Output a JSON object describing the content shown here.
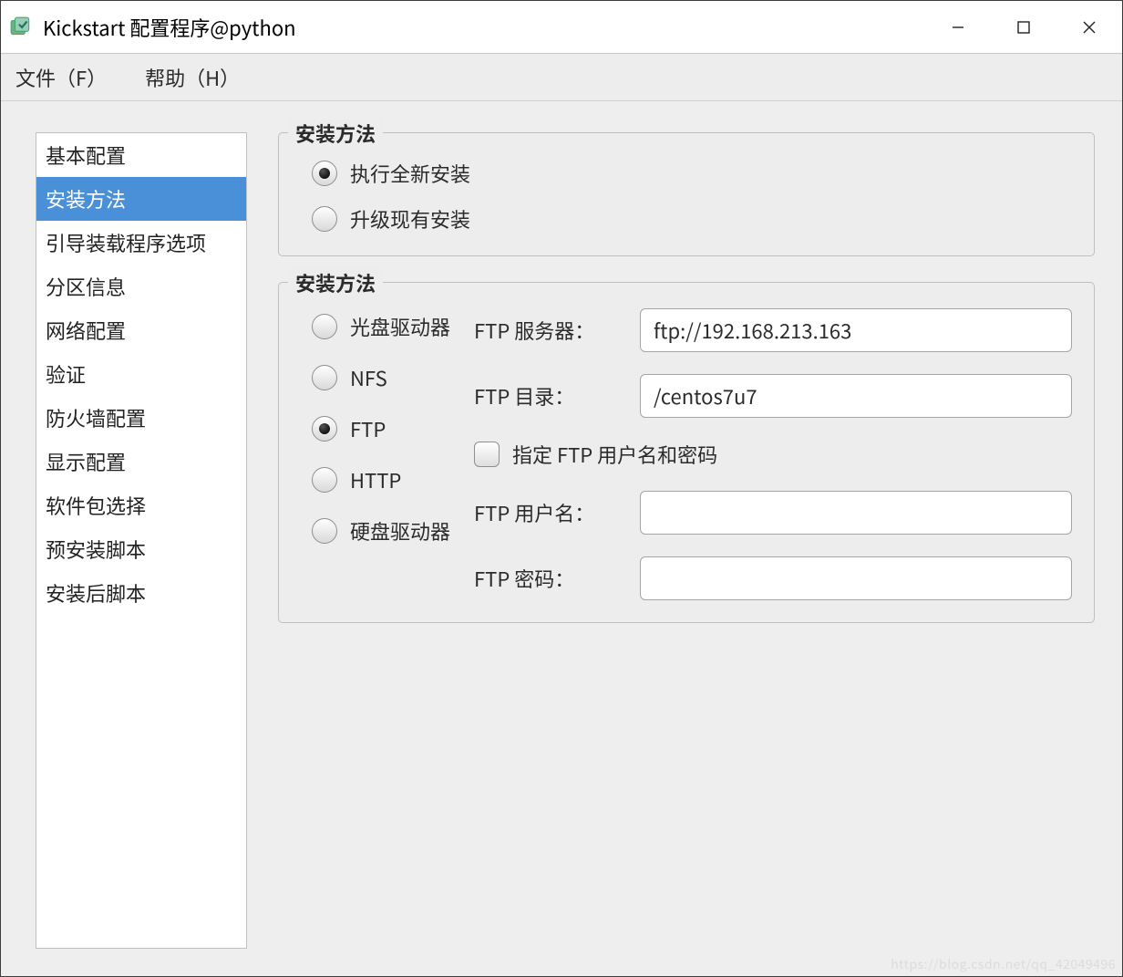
{
  "title": "Kickstart 配置程序@python",
  "menubar": {
    "file": "文件（F）",
    "help": "帮助（H）"
  },
  "sidebar": {
    "items": [
      {
        "label": "基本配置"
      },
      {
        "label": "安装方法"
      },
      {
        "label": "引导装载程序选项"
      },
      {
        "label": "分区信息"
      },
      {
        "label": "网络配置"
      },
      {
        "label": "验证"
      },
      {
        "label": "防火墙配置"
      },
      {
        "label": "显示配置"
      },
      {
        "label": "软件包选择"
      },
      {
        "label": "预安装脚本"
      },
      {
        "label": "安装后脚本"
      }
    ],
    "selectedIndex": 1
  },
  "group1": {
    "legend": "安装方法",
    "options": [
      {
        "label": "执行全新安装",
        "checked": true
      },
      {
        "label": "升级现有安装",
        "checked": false
      }
    ]
  },
  "group2": {
    "legend": "安装方法",
    "methods": [
      {
        "label": "光盘驱动器",
        "checked": false
      },
      {
        "label": "NFS",
        "checked": false
      },
      {
        "label": "FTP",
        "checked": true
      },
      {
        "label": "HTTP",
        "checked": false
      },
      {
        "label": "硬盘驱动器",
        "checked": false
      }
    ],
    "ftp": {
      "server_label": "FTP 服务器：",
      "server_value": "ftp://192.168.213.163",
      "dir_label": "FTP 目录：",
      "dir_value": "/centos7u7",
      "auth_label": "指定 FTP 用户名和密码",
      "auth_checked": false,
      "user_label": "FTP 用户名：",
      "user_value": "",
      "pass_label": "FTP 密码：",
      "pass_value": ""
    }
  },
  "watermark": "https://blog.csdn.net/qq_42049496"
}
